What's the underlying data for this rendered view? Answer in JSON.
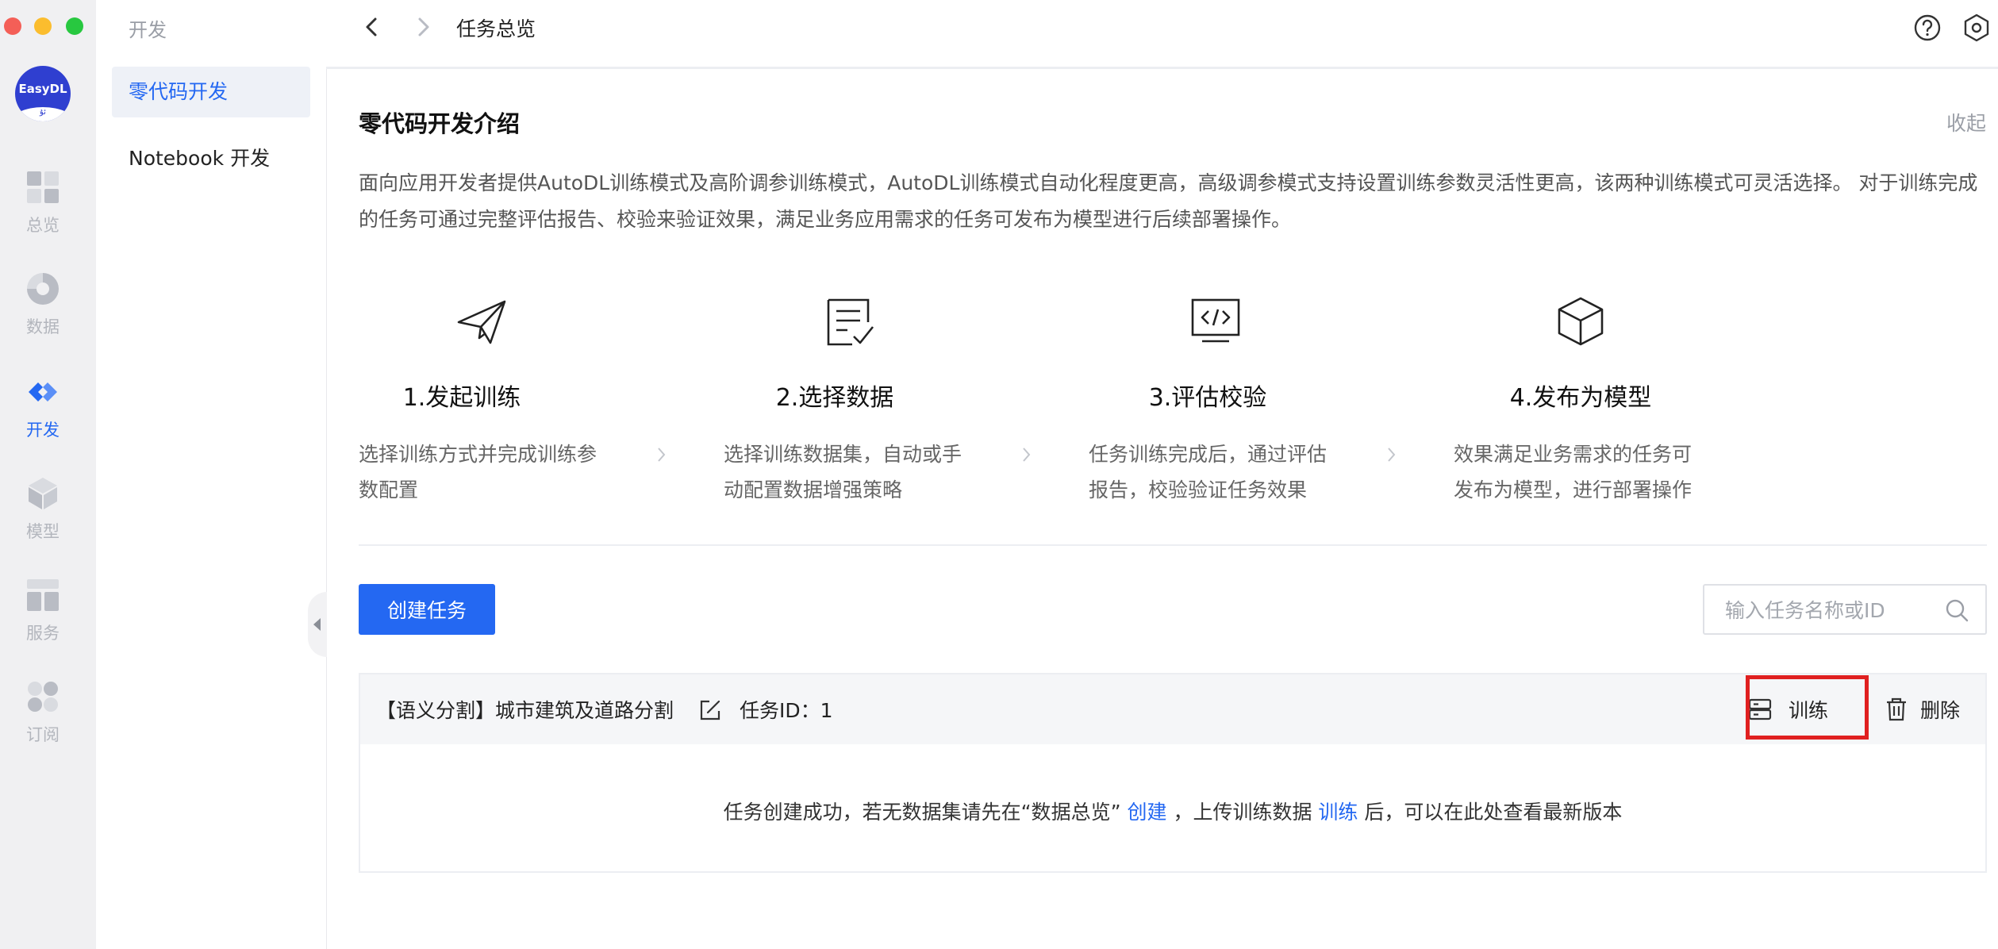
{
  "rail": {
    "logo_text": "EasyDL",
    "logo_mark": "ﺋﯘ",
    "items": [
      {
        "label": "总览",
        "icon": "dashboard-grid-icon"
      },
      {
        "label": "数据",
        "icon": "pie-chart-icon"
      },
      {
        "label": "开发",
        "icon": "code-brackets-icon"
      },
      {
        "label": "模型",
        "icon": "cube-icon"
      },
      {
        "label": "服务",
        "icon": "layout-panels-icon"
      },
      {
        "label": "订阅",
        "icon": "subscribe-icon"
      }
    ],
    "active_index": 2
  },
  "subnav": {
    "title": "开发",
    "items": [
      {
        "label": "零代码开发",
        "active": true
      },
      {
        "label": "Notebook 开发",
        "active": false
      }
    ]
  },
  "topbar": {
    "breadcrumb": "任务总览",
    "icons": [
      "chevron-left-icon",
      "chevron-right-icon",
      "help-icon",
      "settings-hexagon-icon"
    ]
  },
  "intro": {
    "title": "零代码开发介绍",
    "collapse_label": "收起",
    "description": "面向应用开发者提供AutoDL训练模式及高阶调参训练模式，AutoDL训练模式自动化程度更高，高级调参模式支持设置训练参数灵活性更高，该两种训练模式可灵活选择。 对于训练完成的任务可通过完整评估报告、校验来验证效果，满足业务应用需求的任务可发布为模型进行后续部署操作。"
  },
  "steps": [
    {
      "title": "1.发起训练",
      "desc_line1": "选择训练方式并完成训练参",
      "desc_line2": "数配置",
      "icon": "paper-plane-icon"
    },
    {
      "title": "2.选择数据",
      "desc_line1": "选择训练数据集，自动或手",
      "desc_line2": "动配置数据增强策略",
      "icon": "checklist-document-icon"
    },
    {
      "title": "3.评估校验",
      "desc_line1": "任务训练完成后，通过评估",
      "desc_line2": "报告，校验验证任务效果",
      "icon": "code-monitor-icon"
    },
    {
      "title": "4.发布为模型",
      "desc_line1": "效果满足业务需求的任务可",
      "desc_line2": "发布为模型，进行部署操作",
      "icon": "cube-outline-icon"
    }
  ],
  "toolbar": {
    "create_label": "创建任务",
    "search_placeholder": "输入任务名称或ID"
  },
  "task": {
    "name": "【语义分割】城市建筑及道路分割",
    "id_label": "任务ID：1",
    "train_label": "训练",
    "delete_label": "删除",
    "msg_before": "任务创建成功，若无数据集请先在“数据总览”",
    "msg_link1": "创建",
    "msg_middle": "，上传训练数据",
    "msg_link2": "训练",
    "msg_after": "后，可以在此处查看最新版本"
  },
  "colors": {
    "accent": "#2468f2",
    "highlight": "#e02020",
    "rail_bg": "#f0f0f2"
  }
}
